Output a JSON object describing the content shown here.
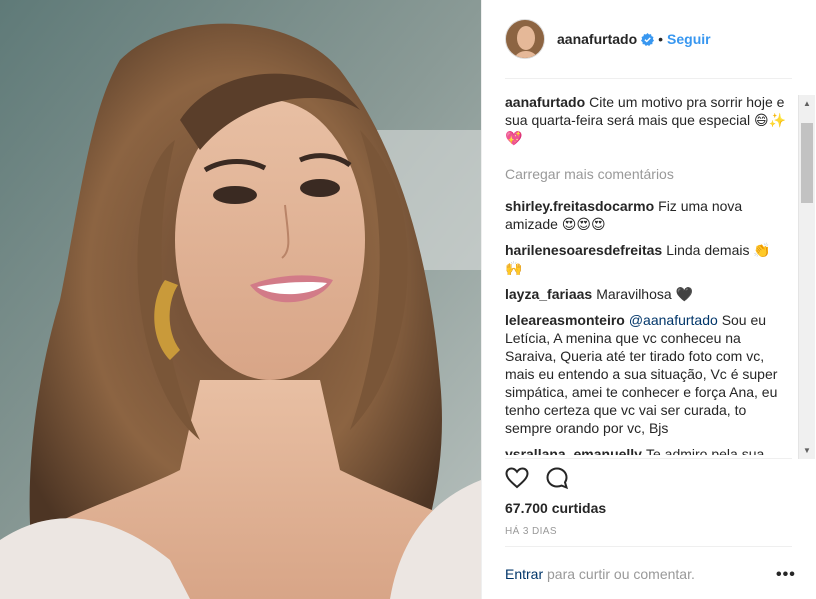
{
  "post": {
    "photo_alt": "",
    "author": "aanafurtado",
    "follow_label": "Seguir",
    "separator": "•",
    "caption": "Cite um motivo pra sorrir hoje e sua quarta-feira será mais que especial 😄✨💖",
    "load_more": "Carregar mais comentários",
    "comments": [
      {
        "user": "shirley.freitasdocarmo",
        "text": "Fiz uma nova amizade 😍😍😍"
      },
      {
        "user": "harilenesoaresdefreitas",
        "text": "Linda demais 👏🙌"
      },
      {
        "user": "layza_fariaas",
        "text": "Maravilhosa 🖤"
      },
      {
        "user": "leleareasmonteiro",
        "mention": "@aanafurtado",
        "text": "Sou eu Letícia, A menina que vc conheceu na Saraiva, Queria até ter tirado foto com vc, mais eu entendo a sua situação, Vc é super simpática, amei te conhecer e força Ana, eu tenho certeza que vc vai ser curada, to sempre orando por vc, Bjs"
      },
      {
        "user": "ysrallana_emanuelly",
        "text": "Te admiro pela sua garra😍 estou orando por vc minha guerreira 🙏❤️😘😘"
      }
    ],
    "likes": "67.700 curtidas",
    "age": "HÁ 3 DIAS",
    "login_link": "Entrar",
    "login_rest": "para curtir ou comentar.",
    "more_options": "•••"
  },
  "icons": {
    "like": "heart-outline-icon",
    "comment": "comment-bubble-icon",
    "verified": "verified-badge-icon",
    "more": "more-options-icon"
  },
  "colors": {
    "link": "#3897f0",
    "muted": "#999999",
    "text": "#262626",
    "verified": "#3897f0"
  }
}
